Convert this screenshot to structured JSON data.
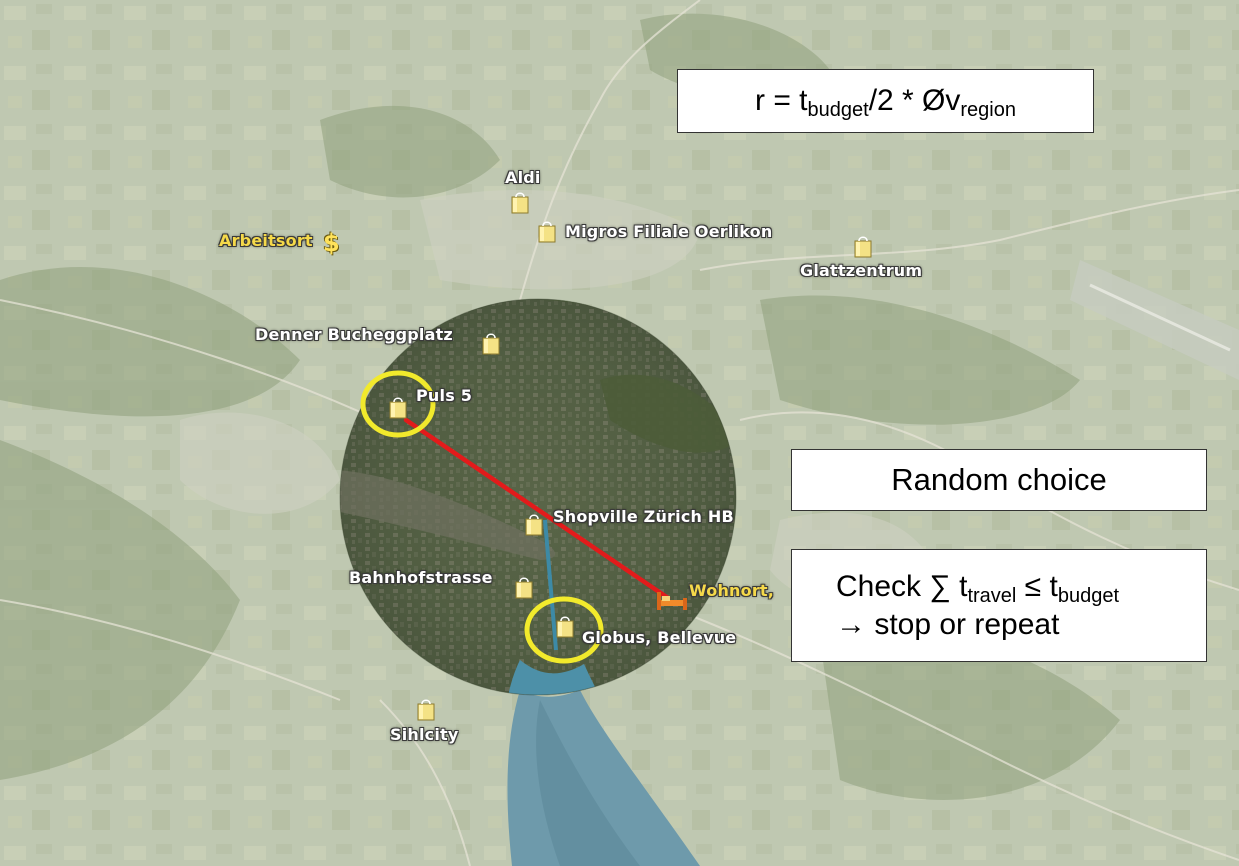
{
  "formula": {
    "prefix": "r = t",
    "sub_budget": "budget",
    "mid": "/2 * Øv",
    "sub_region": "region"
  },
  "random_choice": "Random choice",
  "check": {
    "line1_prefix": "Check ∑ t",
    "sub_travel": "travel",
    "line1_mid": " ≤ t",
    "sub_budget": "budget",
    "line2": "→  stop or repeat"
  },
  "places": {
    "aldi": "Aldi",
    "migros": "Migros Filiale Oerlikon",
    "arbeitsort": "Arbeitsort",
    "glattzentrum": "Glattzentrum",
    "denner": "Denner Bucheggplatz",
    "puls5": "Puls 5",
    "shopville": "Shopville Zürich HB",
    "bahnhofstrasse": "Bahnhofstrasse",
    "wohnort": "Wohnort,",
    "globus": "Globus, Bellevue",
    "sihlcity": "Sihlcity"
  },
  "icons": {
    "shop": "shopping-bag-icon",
    "work": "dollar-icon",
    "home": "bed-icon"
  },
  "colors": {
    "route": "#e21b1b",
    "highlight_ring": "#f2ea2c",
    "map_base": "#b7c2a8",
    "circle_dark": "#4f5a3f",
    "lake": "#5f94a8"
  }
}
